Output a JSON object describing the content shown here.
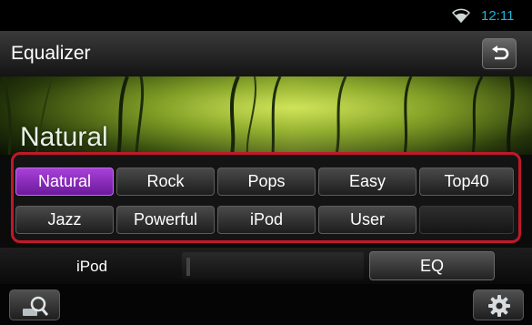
{
  "status": {
    "time": "12:11",
    "wifi_icon": "wifi-icon",
    "accent_color": "#1fb5d8"
  },
  "header": {
    "title": "Equalizer",
    "back_icon": "back-arrow-icon"
  },
  "banner": {
    "current_preset": "Natural"
  },
  "presets": [
    {
      "label": "Natural",
      "selected": true
    },
    {
      "label": "Rock",
      "selected": false
    },
    {
      "label": "Pops",
      "selected": false
    },
    {
      "label": "Easy",
      "selected": false
    },
    {
      "label": "Top40",
      "selected": false
    },
    {
      "label": "Jazz",
      "selected": false
    },
    {
      "label": "Powerful",
      "selected": false
    },
    {
      "label": "iPod",
      "selected": false
    },
    {
      "label": "User",
      "selected": false
    }
  ],
  "bottom": {
    "source_label": "iPod",
    "eq_label": "EQ"
  },
  "footer": {
    "search_icon": "search-icon",
    "settings_icon": "gear-icon"
  },
  "colors": {
    "selected_preset": "#8a2bc2",
    "panel_border": "#c0182a"
  }
}
